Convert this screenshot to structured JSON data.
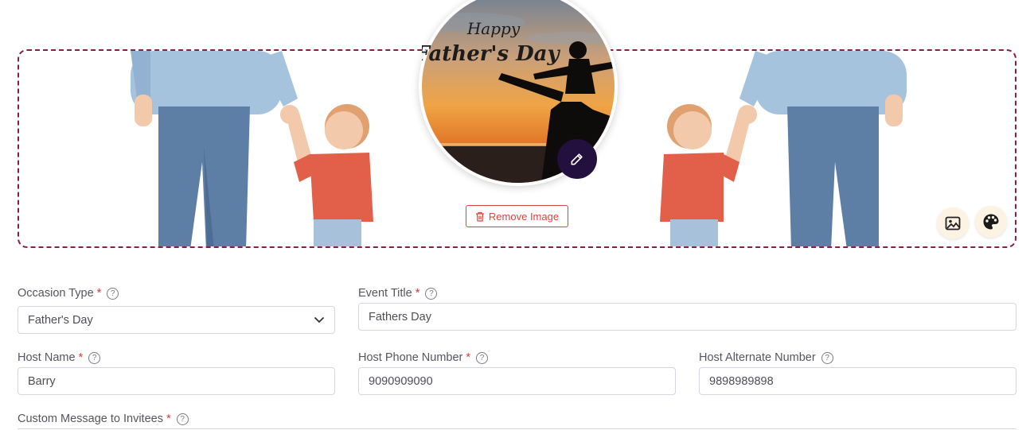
{
  "banner": {
    "avatar_heading_line1": "Happy",
    "avatar_heading_line2": "Father's Day",
    "remove_image_label": "Remove Image"
  },
  "form": {
    "occasion_type": {
      "label": "Occasion Type",
      "value": "Father's Day"
    },
    "event_title": {
      "label": "Event Title",
      "value": "Fathers Day"
    },
    "host_name": {
      "label": "Host Name",
      "value": "Barry"
    },
    "host_phone": {
      "label": "Host Phone Number",
      "value": "9090909090"
    },
    "host_alternate": {
      "label": "Host Alternate Number",
      "value": "9898989898"
    },
    "custom_message": {
      "label": "Custom Message to Invitees"
    },
    "required_mark": "*",
    "help_glyph": "?"
  },
  "colors": {
    "banner_border": "#8a1f3d",
    "edit_button": "#24103f",
    "remove_button": "#d9453a",
    "required_mark": "#e03a3a"
  },
  "icons": {
    "edit": "pencil-icon",
    "remove": "trash-icon",
    "change_banner": "image-icon",
    "theme": "palette-icon",
    "dropdown": "chevron-down-icon",
    "help": "help-circle-icon"
  }
}
